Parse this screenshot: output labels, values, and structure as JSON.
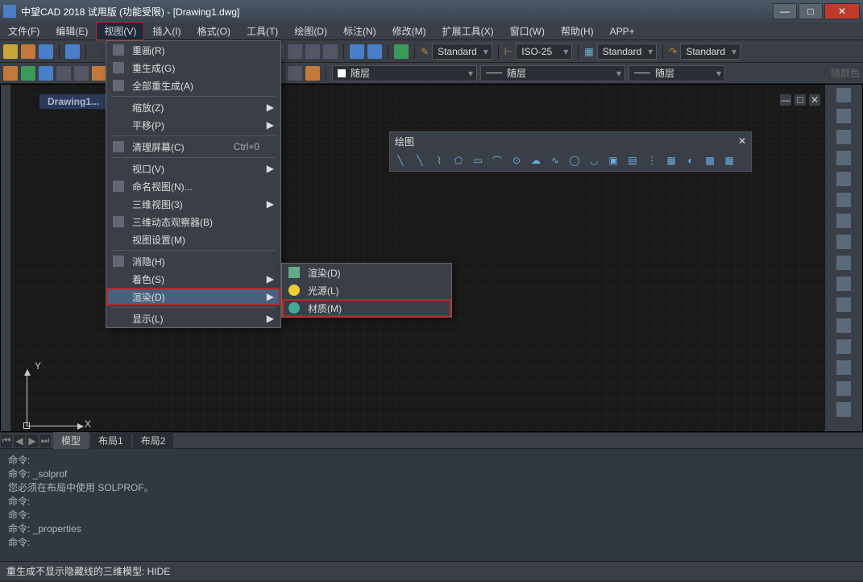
{
  "title": "中望CAD 2018 试用版 (功能受限) - [Drawing1.dwg]",
  "menubar": [
    "文件(F)",
    "编辑(E)",
    "视图(V)",
    "插入(I)",
    "格式(O)",
    "工具(T)",
    "绘图(D)",
    "标注(N)",
    "修改(M)",
    "扩展工具(X)",
    "窗口(W)",
    "帮助(H)",
    "APP+"
  ],
  "open_menu_index": 2,
  "toolbar_dropdowns": {
    "style1": "Standard",
    "style2": "ISO-25",
    "style3": "Standard",
    "style4": "Standard"
  },
  "layer_dropdowns": {
    "l1": "随层",
    "l2": "随层",
    "l3": "随层",
    "disabled": "随颜色"
  },
  "view_menu": [
    {
      "label": "重画(R)",
      "icon": true
    },
    {
      "label": "重生成(G)",
      "icon": true
    },
    {
      "label": "全部重生成(A)",
      "icon": true
    },
    {
      "sep": true
    },
    {
      "label": "缩放(Z)",
      "sub": true
    },
    {
      "label": "平移(P)",
      "sub": true
    },
    {
      "sep": true
    },
    {
      "label": "清理屏幕(C)",
      "shortcut": "Ctrl+0",
      "icon": true
    },
    {
      "sep": true
    },
    {
      "label": "视口(V)",
      "sub": true
    },
    {
      "label": "命名视图(N)...",
      "icon": true
    },
    {
      "label": "三维视图(3)",
      "sub": true
    },
    {
      "label": "三维动态观察器(B)",
      "icon": true
    },
    {
      "label": "视图设置(M)"
    },
    {
      "sep": true
    },
    {
      "label": "消隐(H)",
      "icon": true
    },
    {
      "label": "着色(S)",
      "sub": true
    },
    {
      "label": "渲染(D)",
      "sub": true,
      "hl": true
    },
    {
      "sep": true
    },
    {
      "label": "显示(L)",
      "sub": true
    }
  ],
  "render_submenu": [
    {
      "label": "渲染(D)",
      "icon": "teapot"
    },
    {
      "label": "光源(L)",
      "icon": "bulb"
    },
    {
      "label": "材质(M)",
      "icon": "sphere",
      "hl": true
    }
  ],
  "doc_tab": "Drawing1...",
  "floatbar": {
    "title": "绘图"
  },
  "tabs": {
    "model": "模型",
    "layout1": "布局1",
    "layout2": "布局2"
  },
  "axes": {
    "x": "X",
    "y": "Y"
  },
  "cmd_lines": [
    "命令: ",
    "命令: _solprof",
    "您必须在布局中使用 SOLPROF。",
    "命令: ",
    "命令: ",
    "命令: _properties",
    "命令: "
  ],
  "status": "重生成不显示隐藏线的三维模型: HIDE"
}
